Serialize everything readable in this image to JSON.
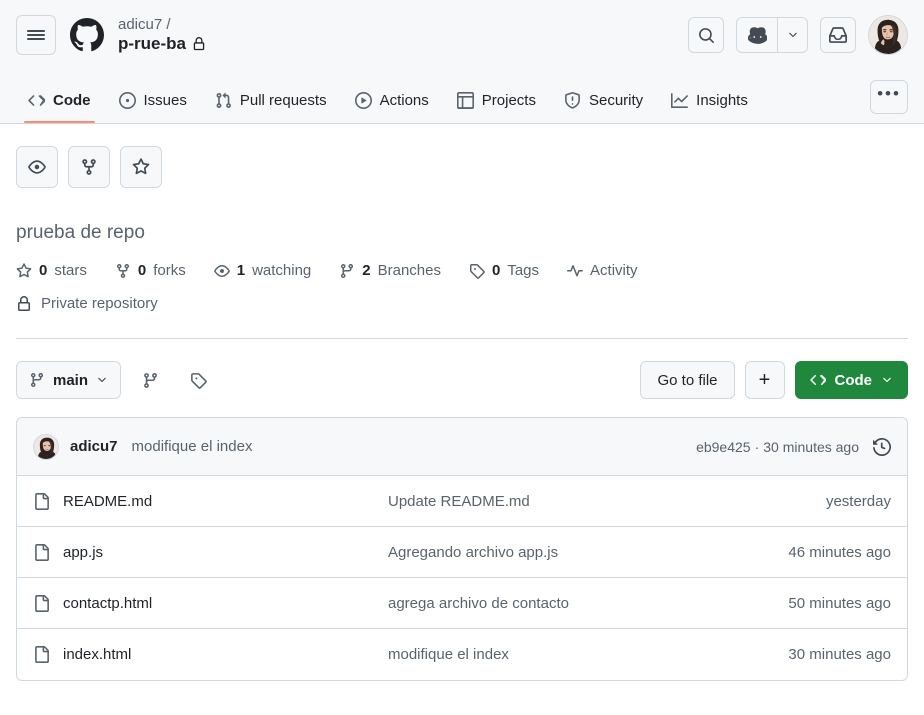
{
  "header": {
    "menu_icon": "hamburger-icon",
    "logo_icon": "github-mark-icon",
    "owner": "adicu7 /",
    "repo_name": "p-rue-ba",
    "lock_icon": "lock-icon",
    "search_icon": "search-icon",
    "copilot_icon": "copilot-icon",
    "copilot_caret_icon": "chevron-down-icon",
    "inbox_icon": "inbox-icon",
    "avatar_icon": "user-avatar"
  },
  "nav": {
    "tabs": [
      {
        "label": "Code",
        "icon": "code-icon",
        "active": true
      },
      {
        "label": "Issues",
        "icon": "issue-opened-icon",
        "active": false
      },
      {
        "label": "Pull requests",
        "icon": "git-pull-request-icon",
        "active": false
      },
      {
        "label": "Actions",
        "icon": "play-icon",
        "active": false
      },
      {
        "label": "Projects",
        "icon": "table-icon",
        "active": false
      },
      {
        "label": "Security",
        "icon": "shield-icon",
        "active": false
      },
      {
        "label": "Insights",
        "icon": "graph-icon",
        "active": false
      }
    ],
    "overflow_label": "•••"
  },
  "repo_actions": {
    "watch_icon": "eye-icon",
    "fork_icon": "repo-forked-icon",
    "star_icon": "star-icon"
  },
  "about": {
    "description": "prueba de repo"
  },
  "stats": [
    {
      "icon": "star-icon",
      "count": "0",
      "label": "stars"
    },
    {
      "icon": "repo-forked-icon",
      "count": "0",
      "label": "forks"
    },
    {
      "icon": "eye-icon",
      "count": "1",
      "label": "watching"
    },
    {
      "icon": "git-branch-icon",
      "count": "2",
      "label": "Branches"
    },
    {
      "icon": "tag-icon",
      "count": "0",
      "label": "Tags"
    },
    {
      "icon": "pulse-icon",
      "count": "",
      "label": "Activity"
    }
  ],
  "privacy": {
    "icon": "lock-icon",
    "label": "Private repository"
  },
  "filebar": {
    "branch_icon": "git-branch-icon",
    "branch_name": "main",
    "branch_caret_icon": "chevron-down-icon",
    "branches_icon": "git-branch-icon",
    "tags_icon": "tag-icon",
    "go_to_file_label": "Go to file",
    "add_file_label": "+",
    "code_button_label": "Code",
    "code_button_icon": "code-icon",
    "code_button_caret_icon": "chevron-down-icon",
    "code_button_color": "#1f883d"
  },
  "commit": {
    "avatar_icon": "user-avatar",
    "author": "adicu7",
    "message": "modifique el index",
    "hash": "eb9e425",
    "separator": "·",
    "time": "30 minutes ago",
    "history_icon": "history-icon"
  },
  "files": [
    {
      "icon": "file-icon",
      "name": "README.md",
      "message": "Update README.md",
      "time": "yesterday"
    },
    {
      "icon": "file-icon",
      "name": "app.js",
      "message": "Agregando archivo app.js",
      "time": "46 minutes ago"
    },
    {
      "icon": "file-icon",
      "name": "contactp.html",
      "message": "agrega archivo de contacto",
      "time": "50 minutes ago"
    },
    {
      "icon": "file-icon",
      "name": "index.html",
      "message": "modifique el index",
      "time": "30 minutes ago"
    }
  ],
  "colors": {
    "accent_green": "#1f883d",
    "active_tab_underline": "#fd8c73",
    "border": "#d1d9e0",
    "header_bg": "#f6f8fa",
    "muted_text": "#59636e"
  }
}
